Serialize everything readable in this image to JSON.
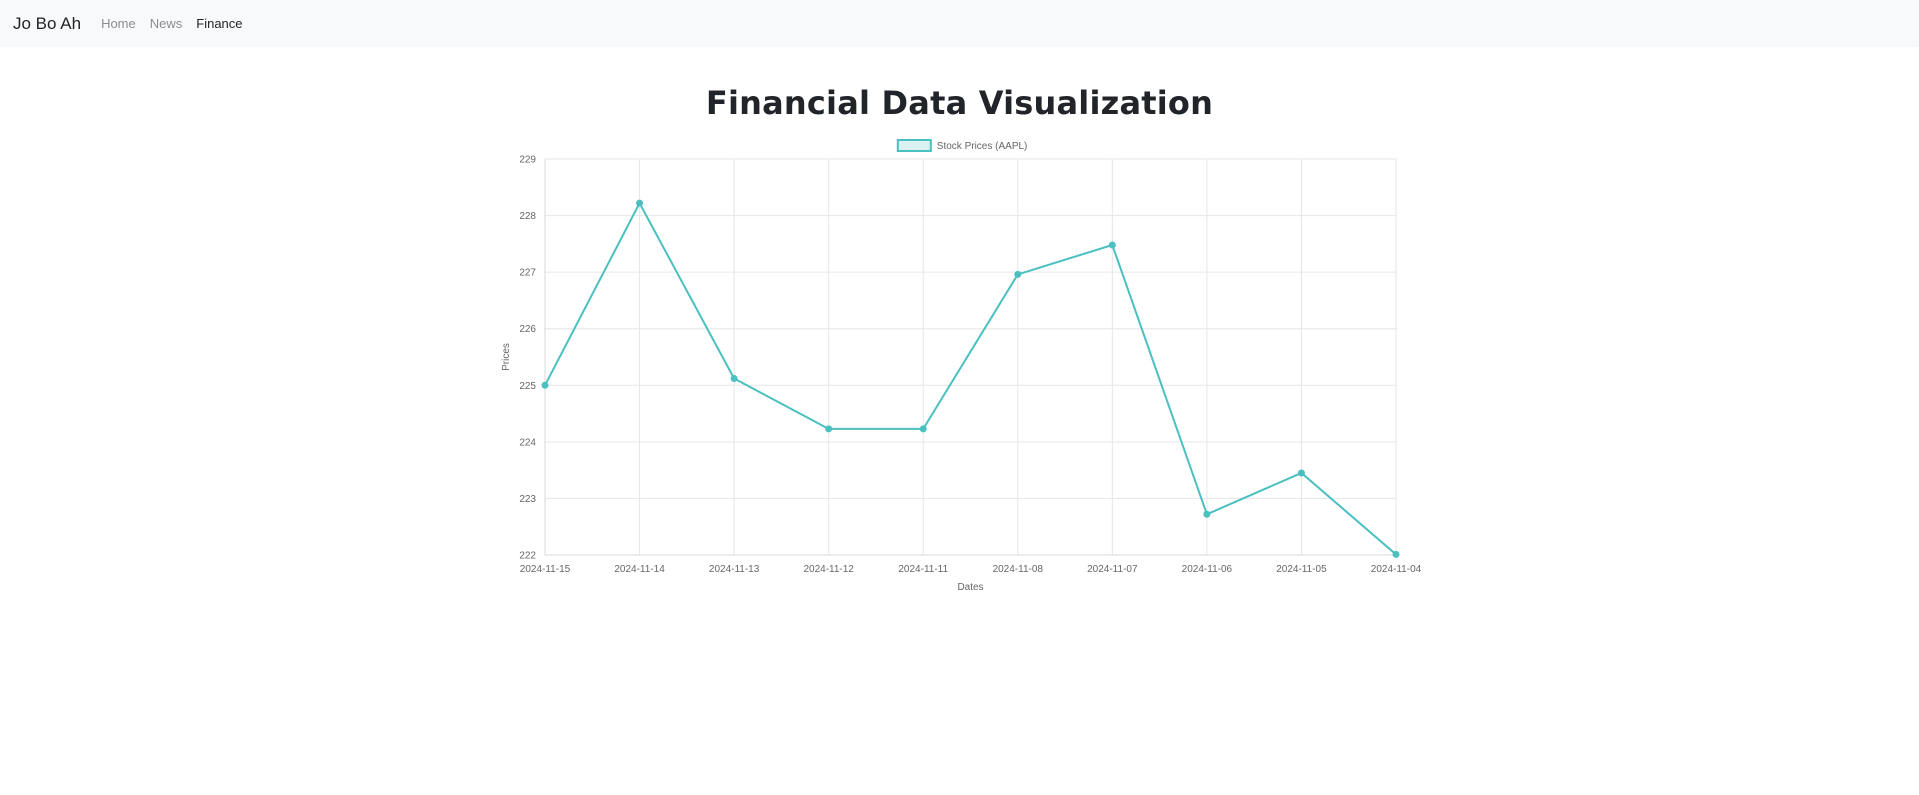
{
  "navbar": {
    "brand": "Jo Bo Ah",
    "links": [
      {
        "label": "Home",
        "active": false
      },
      {
        "label": "News",
        "active": false
      },
      {
        "label": "Finance",
        "active": true
      }
    ]
  },
  "page": {
    "title": "Financial Data Visualization"
  },
  "chart_data": {
    "type": "line",
    "categories": [
      "2024-11-15",
      "2024-11-14",
      "2024-11-13",
      "2024-11-12",
      "2024-11-11",
      "2024-11-08",
      "2024-11-07",
      "2024-11-06",
      "2024-11-05",
      "2024-11-04"
    ],
    "series": [
      {
        "name": "Stock Prices (AAPL)",
        "values": [
          225.0,
          228.22,
          225.12,
          224.23,
          224.23,
          226.96,
          227.48,
          222.72,
          223.45,
          222.01
        ],
        "color": "#4bc0c0"
      }
    ],
    "xlabel": "Dates",
    "ylabel": "Prices",
    "ylim": [
      222,
      229
    ],
    "yticks": [
      "222",
      "223",
      "224",
      "225",
      "226",
      "227",
      "228",
      "229"
    ],
    "grid": true,
    "legend": "top-center"
  }
}
